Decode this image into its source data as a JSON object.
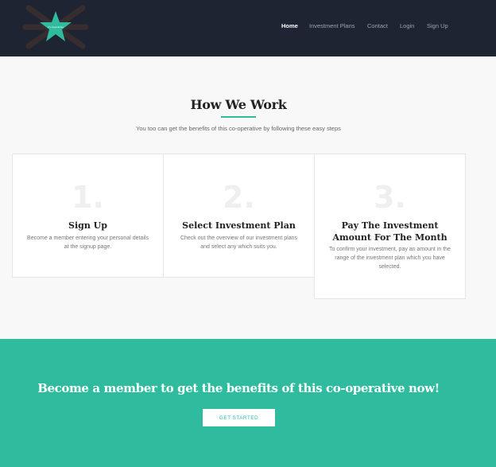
{
  "header": {
    "logo_text": "Co-Operative",
    "nav": [
      {
        "label": "Home",
        "active": true
      },
      {
        "label": "Investment Plans",
        "active": false
      },
      {
        "label": "Contact",
        "active": false
      },
      {
        "label": "Login",
        "active": false
      },
      {
        "label": "Sign Up",
        "active": false
      }
    ]
  },
  "how_we_work": {
    "title": "How We Work",
    "subtitle": "You too can get the benefits of this co-operative by following these easy steps",
    "steps": [
      {
        "number": "1.",
        "title": "Sign Up",
        "text": "Become a member entering your personal details at the signup page."
      },
      {
        "number": "2.",
        "title": "Select Investment Plan",
        "text": "Check out the overview of our investment plans and select any which suits you."
      },
      {
        "number": "3.",
        "title": "Pay The Investment Amount For The Month",
        "text": "To confirm your investment, pay an amount in the range of the investment plan which you have selected."
      }
    ]
  },
  "cta": {
    "title": "Become a member to get the benefits of this co-operative now!",
    "button_label": "GET STARTED"
  },
  "colors": {
    "navbar_bg": "#1f2433",
    "accent": "#2fbc9e",
    "page_bg": "#f8f8f8"
  }
}
